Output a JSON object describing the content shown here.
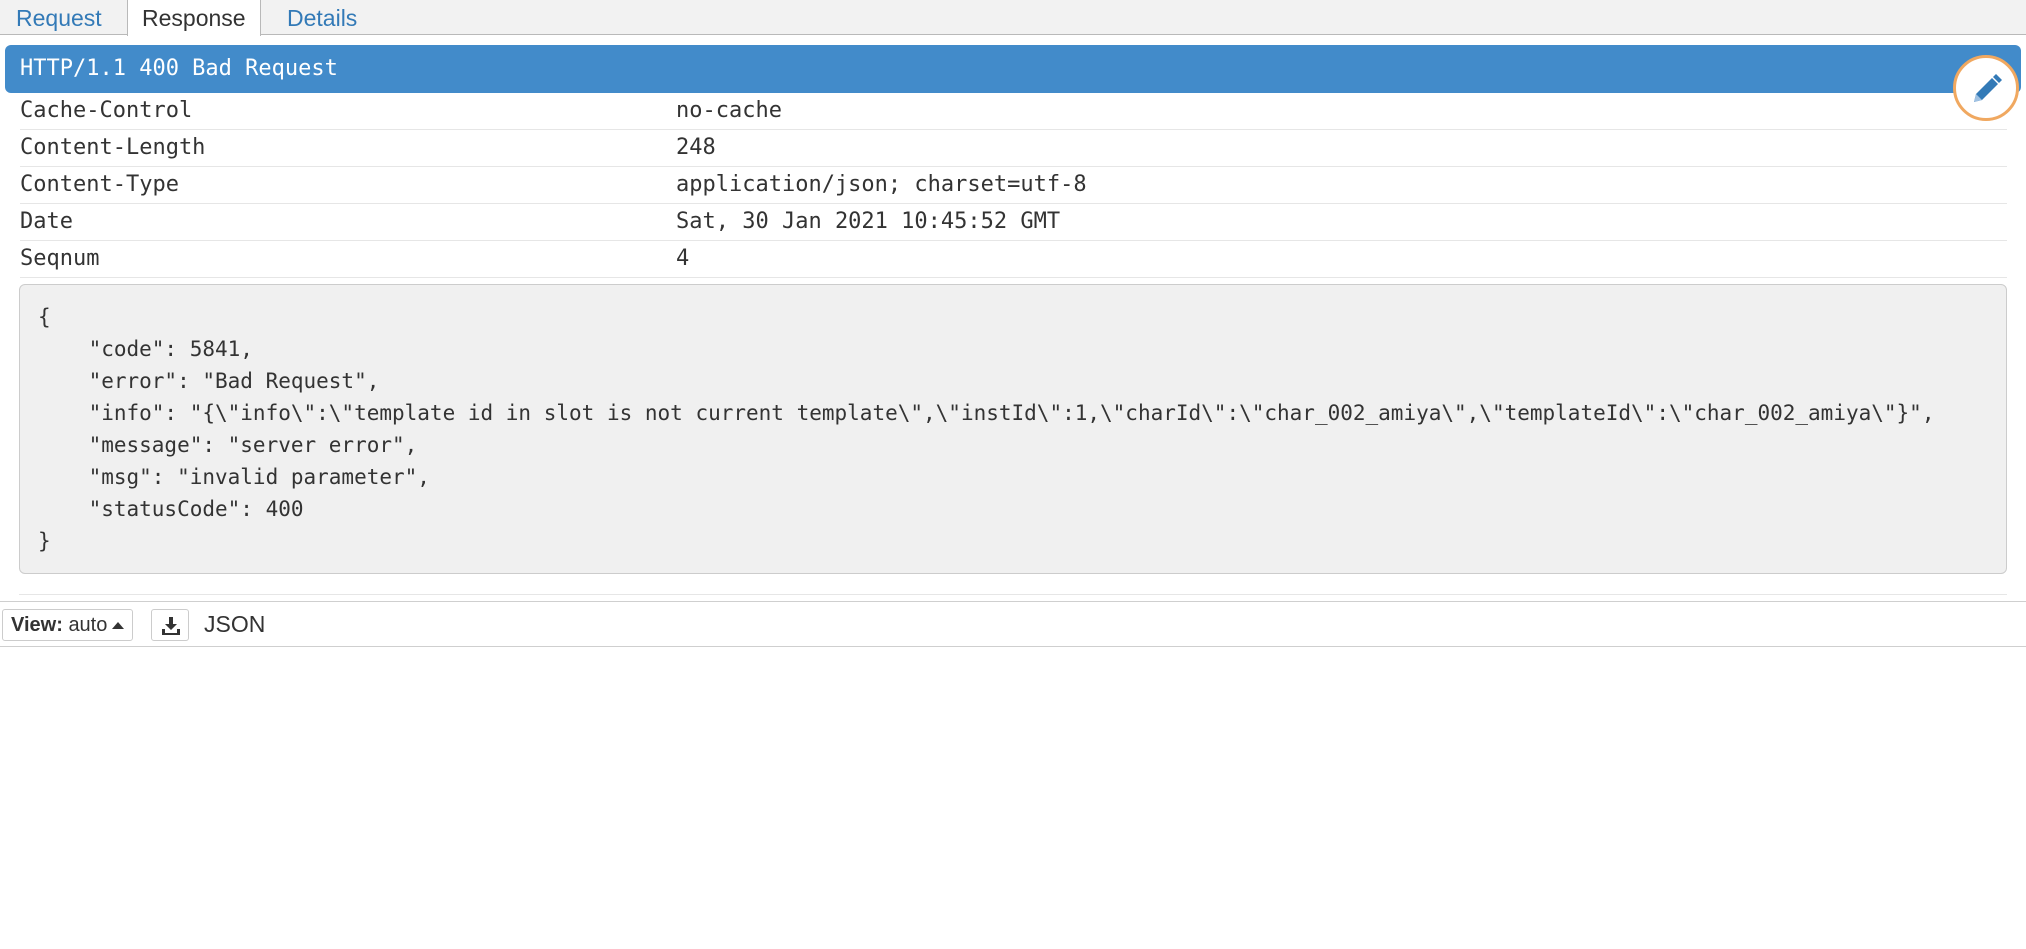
{
  "tabs": [
    {
      "label": "Request",
      "active": false
    },
    {
      "label": "Response",
      "active": true
    },
    {
      "label": "Details",
      "active": false
    }
  ],
  "status_line": "HTTP/1.1 400 Bad Request",
  "colors": {
    "status_bar": "#428bca",
    "link": "#337ab7",
    "edit_ring": "#f0a860"
  },
  "edit_button": {
    "icon": "pencil-icon"
  },
  "headers": [
    {
      "name": "Cache-Control",
      "value": "no-cache"
    },
    {
      "name": "Content-Length",
      "value": "248"
    },
    {
      "name": "Content-Type",
      "value": "application/json; charset=utf-8"
    },
    {
      "name": "Date",
      "value": "Sat, 30 Jan 2021 10:45:52 GMT"
    },
    {
      "name": "Seqnum",
      "value": "4"
    }
  ],
  "body_lines": [
    "{",
    "    \"code\": 5841,",
    "    \"error\": \"Bad Request\",",
    "    \"info\": \"{\\\"info\\\":\\\"template id in slot is not current template\\\",\\\"instId\\\":1,\\\"charId\\\":\\\"char_002_amiya\\\",\\\"templateId\\\":\\\"char_002_amiya\\\"}\",",
    "    \"message\": \"server error\",",
    "    \"msg\": \"invalid parameter\",",
    "    \"statusCode\": 400",
    "}"
  ],
  "bottom_bar": {
    "view_label": "View:",
    "view_value": "auto",
    "download_icon": "download-icon",
    "format": "JSON"
  }
}
